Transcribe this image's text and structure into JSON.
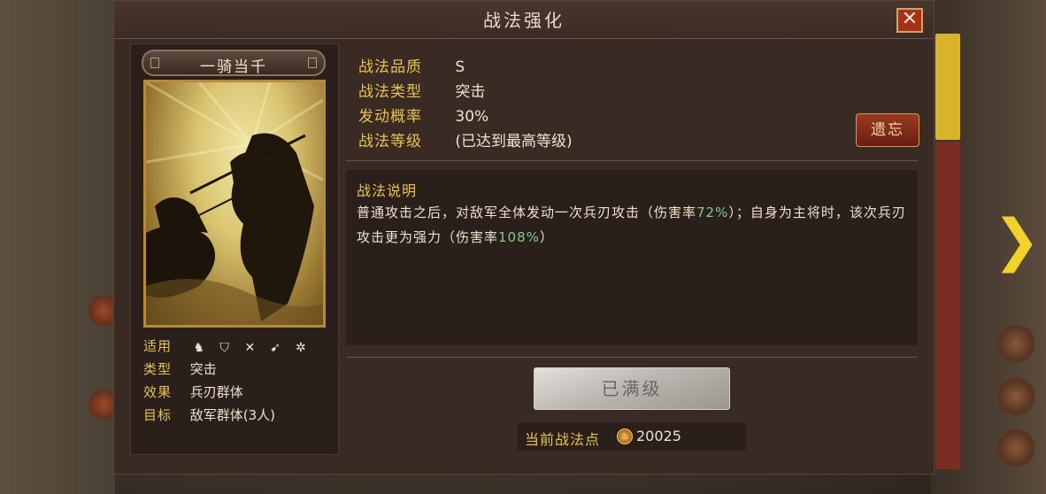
{
  "window": {
    "title": "战法强化",
    "close_label": "✕"
  },
  "skill": {
    "name": "一骑当千",
    "apply_label": "适用",
    "apply_icons": [
      "cavalry-icon",
      "shield-icon",
      "archer-icon",
      "spear-icon",
      "siege-icon"
    ],
    "rows": [
      {
        "key": "类型",
        "value": "突击"
      },
      {
        "key": "效果",
        "value": "兵刃群体"
      },
      {
        "key": "目标",
        "value": "敌军群体(3人)"
      }
    ]
  },
  "attributes": [
    {
      "key": "战法品质",
      "value": "S"
    },
    {
      "key": "战法类型",
      "value": "突击"
    },
    {
      "key": "发动概率",
      "value": "30%"
    },
    {
      "key": "战法等级",
      "value": "(已达到最高等级)"
    }
  ],
  "forget_button": "遗忘",
  "description": {
    "title": "战法说明",
    "part1": "普通攻击之后，对敌军全体发动一次兵刃攻击（伤害率",
    "hl1": "72%",
    "part2": "）；自身为主将时，该次兵刃攻击更为强力（伤害率",
    "hl2": "108%",
    "part3": "）"
  },
  "maxed_button": "已满级",
  "points": {
    "label": "当前战法点",
    "value": "20025"
  },
  "colors": {
    "accent_gold": "#e8c250",
    "highlight_green": "#7fcf8a",
    "panel_bg": "#3a2a24",
    "close_red": "#a3311c"
  }
}
